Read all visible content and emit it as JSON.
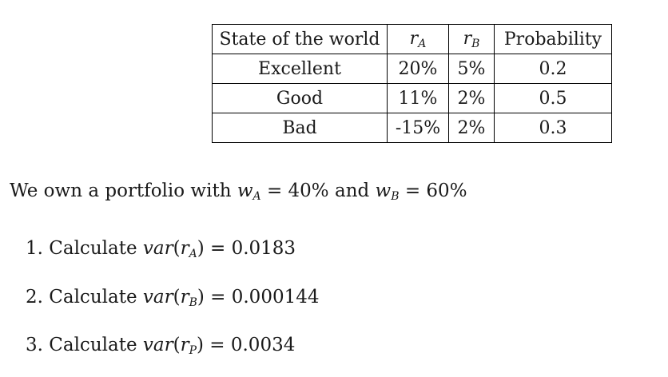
{
  "table": {
    "headers": [
      "State of the world",
      "r",
      "r",
      "Probability"
    ],
    "header_subscripts": [
      "",
      "A",
      "B",
      ""
    ],
    "rows": [
      {
        "state": "Excellent",
        "ra": "20%",
        "rb": "5%",
        "prob": "0.2"
      },
      {
        "state": "Good",
        "ra": "11%",
        "rb": "2%",
        "prob": "0.5"
      },
      {
        "state": "Bad",
        "ra": "-15%",
        "rb": "2%",
        "prob": "0.3"
      }
    ]
  },
  "intro": {
    "prefix": "We own a portfolio with",
    "wa_var": "w",
    "wa_sub": "A",
    "wa_value": "= 40%",
    "conj": "and",
    "wb_var": "w",
    "wb_sub": "B",
    "wb_value": "= 60%"
  },
  "tasks": [
    {
      "num": "1.",
      "verb": "Calculate",
      "fn": "var",
      "arg": "r",
      "sub": "A",
      "result": "= 0.0183"
    },
    {
      "num": "2.",
      "verb": "Calculate",
      "fn": "var",
      "arg": "r",
      "sub": "B",
      "result": "= 0.000144"
    },
    {
      "num": "3.",
      "verb": "Calculate",
      "fn": "var",
      "arg": "r",
      "sub": "P",
      "result": "= 0.0034"
    }
  ]
}
